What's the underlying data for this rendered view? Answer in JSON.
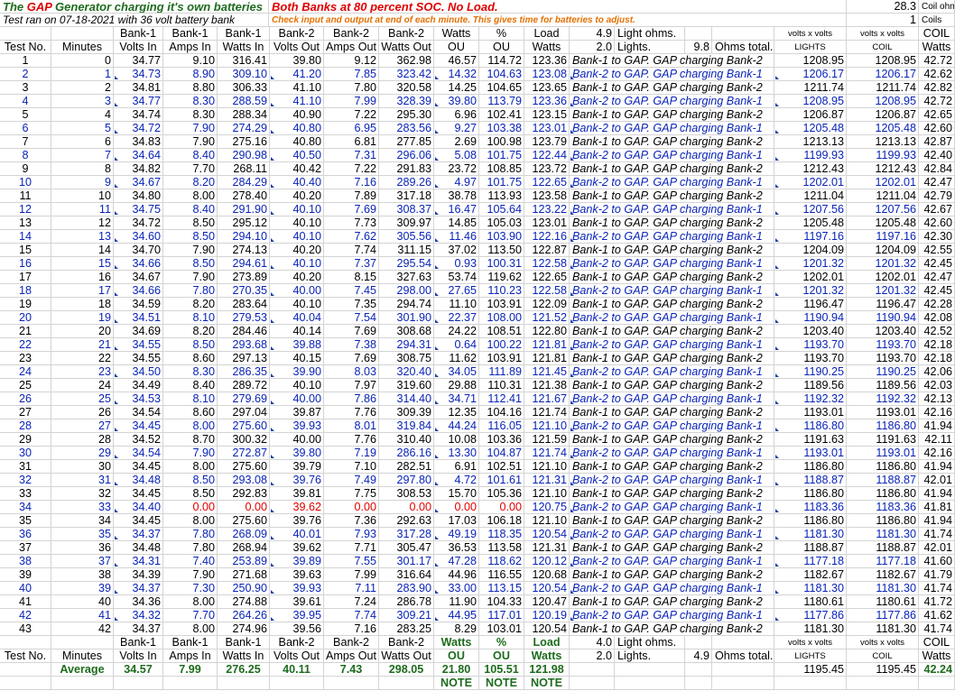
{
  "header": {
    "title_prefix": "The ",
    "title_gap": "GAP",
    "title_suffix": " Generator charging it's own batteries",
    "conditions": "Both Banks at 80 percent SOC. No Load.",
    "test_info": "Test ran on 07-18-2021 with 36 volt battery bank",
    "instructions": "Check input and output at end of each minute. This gives time for batteries to adjust.",
    "coil_ohms_value": "28.3",
    "coil_ohms_label": "Coil ohms",
    "coils_value": "1",
    "coils_label": "Coils"
  },
  "columns": {
    "top": [
      "",
      "",
      "Bank-1",
      "Bank-1",
      "Bank-1",
      "Bank-2",
      "Bank-2",
      "Bank-2",
      "Watts",
      "%",
      "Load",
      "4.9",
      "Light ohms.",
      "",
      "",
      "volts x volts",
      "volts x volts",
      "COIL"
    ],
    "bottom": [
      "Test No.",
      "Minutes",
      "Volts In",
      "Amps In",
      "Watts In",
      "Volts Out",
      "Amps Out",
      "Watts Out",
      "OU",
      "OU",
      "Watts",
      "2.0",
      "Lights.",
      "9.8",
      "Ohms total.",
      "LIGHTS",
      "COIL",
      "Watts"
    ]
  },
  "rows": [
    [
      "1",
      "0",
      "34.77",
      "9.10",
      "316.41",
      "39.80",
      "9.12",
      "362.98",
      "46.57",
      "114.72",
      "123.36",
      "Bank-1 to GAP. GAP charging Bank-2",
      "1208.95",
      "1208.95",
      "42.72"
    ],
    [
      "2",
      "1",
      "34.73",
      "8.90",
      "309.10",
      "41.20",
      "7.85",
      "323.42",
      "14.32",
      "104.63",
      "123.08",
      "Bank-2 to GAP. GAP charging Bank-1",
      "1206.17",
      "1206.17",
      "42.62"
    ],
    [
      "3",
      "2",
      "34.81",
      "8.80",
      "306.33",
      "41.10",
      "7.80",
      "320.58",
      "14.25",
      "104.65",
      "123.65",
      "Bank-1 to GAP. GAP charging Bank-2",
      "1211.74",
      "1211.74",
      "42.82"
    ],
    [
      "4",
      "3",
      "34.77",
      "8.30",
      "288.59",
      "41.10",
      "7.99",
      "328.39",
      "39.80",
      "113.79",
      "123.36",
      "Bank-2 to GAP. GAP charging Bank-1",
      "1208.95",
      "1208.95",
      "42.72"
    ],
    [
      "5",
      "4",
      "34.74",
      "8.30",
      "288.34",
      "40.90",
      "7.22",
      "295.30",
      "6.96",
      "102.41",
      "123.15",
      "Bank-1 to GAP. GAP charging Bank-2",
      "1206.87",
      "1206.87",
      "42.65"
    ],
    [
      "6",
      "5",
      "34.72",
      "7.90",
      "274.29",
      "40.80",
      "6.95",
      "283.56",
      "9.27",
      "103.38",
      "123.01",
      "Bank-2 to GAP. GAP charging Bank-1",
      "1205.48",
      "1205.48",
      "42.60"
    ],
    [
      "7",
      "6",
      "34.83",
      "7.90",
      "275.16",
      "40.80",
      "6.81",
      "277.85",
      "2.69",
      "100.98",
      "123.79",
      "Bank-1 to GAP. GAP charging Bank-2",
      "1213.13",
      "1213.13",
      "42.87"
    ],
    [
      "8",
      "7",
      "34.64",
      "8.40",
      "290.98",
      "40.50",
      "7.31",
      "296.06",
      "5.08",
      "101.75",
      "122.44",
      "Bank-2 to GAP. GAP charging Bank-1",
      "1199.93",
      "1199.93",
      "42.40"
    ],
    [
      "9",
      "8",
      "34.82",
      "7.70",
      "268.11",
      "40.42",
      "7.22",
      "291.83",
      "23.72",
      "108.85",
      "123.72",
      "Bank-1 to GAP. GAP charging Bank-2",
      "1212.43",
      "1212.43",
      "42.84"
    ],
    [
      "10",
      "9",
      "34.67",
      "8.20",
      "284.29",
      "40.40",
      "7.16",
      "289.26",
      "4.97",
      "101.75",
      "122.65",
      "Bank-2 to GAP. GAP charging Bank-1",
      "1202.01",
      "1202.01",
      "42.47"
    ],
    [
      "11",
      "10",
      "34.80",
      "8.00",
      "278.40",
      "40.20",
      "7.89",
      "317.18",
      "38.78",
      "113.93",
      "123.58",
      "Bank-1 to GAP. GAP charging Bank-2",
      "1211.04",
      "1211.04",
      "42.79"
    ],
    [
      "12",
      "11",
      "34.75",
      "8.40",
      "291.90",
      "40.10",
      "7.69",
      "308.37",
      "16.47",
      "105.64",
      "123.22",
      "Bank-2 to GAP. GAP charging Bank-1",
      "1207.56",
      "1207.56",
      "42.67"
    ],
    [
      "13",
      "12",
      "34.72",
      "8.50",
      "295.12",
      "40.10",
      "7.73",
      "309.97",
      "14.85",
      "105.03",
      "123.01",
      "Bank-1 to GAP. GAP charging Bank-2",
      "1205.48",
      "1205.48",
      "42.60"
    ],
    [
      "14",
      "13",
      "34.60",
      "8.50",
      "294.10",
      "40.10",
      "7.62",
      "305.56",
      "11.46",
      "103.90",
      "122.16",
      "Bank-2 to GAP. GAP charging Bank-1",
      "1197.16",
      "1197.16",
      "42.30"
    ],
    [
      "15",
      "14",
      "34.70",
      "7.90",
      "274.13",
      "40.20",
      "7.74",
      "311.15",
      "37.02",
      "113.50",
      "122.87",
      "Bank-1 to GAP. GAP charging Bank-2",
      "1204.09",
      "1204.09",
      "42.55"
    ],
    [
      "16",
      "15",
      "34.66",
      "8.50",
      "294.61",
      "40.10",
      "7.37",
      "295.54",
      "0.93",
      "100.31",
      "122.58",
      "Bank-2 to GAP. GAP charging Bank-1",
      "1201.32",
      "1201.32",
      "42.45"
    ],
    [
      "17",
      "16",
      "34.67",
      "7.90",
      "273.89",
      "40.20",
      "8.15",
      "327.63",
      "53.74",
      "119.62",
      "122.65",
      "Bank-1 to GAP. GAP charging Bank-2",
      "1202.01",
      "1202.01",
      "42.47"
    ],
    [
      "18",
      "17",
      "34.66",
      "7.80",
      "270.35",
      "40.00",
      "7.45",
      "298.00",
      "27.65",
      "110.23",
      "122.58",
      "Bank-2 to GAP. GAP charging Bank-1",
      "1201.32",
      "1201.32",
      "42.45"
    ],
    [
      "19",
      "18",
      "34.59",
      "8.20",
      "283.64",
      "40.10",
      "7.35",
      "294.74",
      "11.10",
      "103.91",
      "122.09",
      "Bank-1 to GAP. GAP charging Bank-2",
      "1196.47",
      "1196.47",
      "42.28"
    ],
    [
      "20",
      "19",
      "34.51",
      "8.10",
      "279.53",
      "40.04",
      "7.54",
      "301.90",
      "22.37",
      "108.00",
      "121.52",
      "Bank-2 to GAP. GAP charging Bank-1",
      "1190.94",
      "1190.94",
      "42.08"
    ],
    [
      "21",
      "20",
      "34.69",
      "8.20",
      "284.46",
      "40.14",
      "7.69",
      "308.68",
      "24.22",
      "108.51",
      "122.80",
      "Bank-1 to GAP. GAP charging Bank-2",
      "1203.40",
      "1203.40",
      "42.52"
    ],
    [
      "22",
      "21",
      "34.55",
      "8.50",
      "293.68",
      "39.88",
      "7.38",
      "294.31",
      "0.64",
      "100.22",
      "121.81",
      "Bank-2 to GAP. GAP charging Bank-1",
      "1193.70",
      "1193.70",
      "42.18"
    ],
    [
      "23",
      "22",
      "34.55",
      "8.60",
      "297.13",
      "40.15",
      "7.69",
      "308.75",
      "11.62",
      "103.91",
      "121.81",
      "Bank-1 to GAP. GAP charging Bank-2",
      "1193.70",
      "1193.70",
      "42.18"
    ],
    [
      "24",
      "23",
      "34.50",
      "8.30",
      "286.35",
      "39.90",
      "8.03",
      "320.40",
      "34.05",
      "111.89",
      "121.45",
      "Bank-2 to GAP. GAP charging Bank-1",
      "1190.25",
      "1190.25",
      "42.06"
    ],
    [
      "25",
      "24",
      "34.49",
      "8.40",
      "289.72",
      "40.10",
      "7.97",
      "319.60",
      "29.88",
      "110.31",
      "121.38",
      "Bank-1 to GAP. GAP charging Bank-2",
      "1189.56",
      "1189.56",
      "42.03"
    ],
    [
      "26",
      "25",
      "34.53",
      "8.10",
      "279.69",
      "40.00",
      "7.86",
      "314.40",
      "34.71",
      "112.41",
      "121.67",
      "Bank-2 to GAP. GAP charging Bank-1",
      "1192.32",
      "1192.32",
      "42.13"
    ],
    [
      "27",
      "26",
      "34.54",
      "8.60",
      "297.04",
      "39.87",
      "7.76",
      "309.39",
      "12.35",
      "104.16",
      "121.74",
      "Bank-1 to GAP. GAP charging Bank-2",
      "1193.01",
      "1193.01",
      "42.16"
    ],
    [
      "28",
      "27",
      "34.45",
      "8.00",
      "275.60",
      "39.93",
      "8.01",
      "319.84",
      "44.24",
      "116.05",
      "121.10",
      "Bank-2 to GAP. GAP charging Bank-1",
      "1186.80",
      "1186.80",
      "41.94"
    ],
    [
      "29",
      "28",
      "34.52",
      "8.70",
      "300.32",
      "40.00",
      "7.76",
      "310.40",
      "10.08",
      "103.36",
      "121.59",
      "Bank-1 to GAP. GAP charging Bank-2",
      "1191.63",
      "1191.63",
      "42.11"
    ],
    [
      "30",
      "29",
      "34.54",
      "7.90",
      "272.87",
      "39.80",
      "7.19",
      "286.16",
      "13.30",
      "104.87",
      "121.74",
      "Bank-2 to GAP. GAP charging Bank-1",
      "1193.01",
      "1193.01",
      "42.16"
    ],
    [
      "31",
      "30",
      "34.45",
      "8.00",
      "275.60",
      "39.79",
      "7.10",
      "282.51",
      "6.91",
      "102.51",
      "121.10",
      "Bank-1 to GAP. GAP charging Bank-2",
      "1186.80",
      "1186.80",
      "41.94"
    ],
    [
      "32",
      "31",
      "34.48",
      "8.50",
      "293.08",
      "39.76",
      "7.49",
      "297.80",
      "4.72",
      "101.61",
      "121.31",
      "Bank-2 to GAP. GAP charging Bank-1",
      "1188.87",
      "1188.87",
      "42.01"
    ],
    [
      "33",
      "32",
      "34.45",
      "8.50",
      "292.83",
      "39.81",
      "7.75",
      "308.53",
      "15.70",
      "105.36",
      "121.10",
      "Bank-1 to GAP. GAP charging Bank-2",
      "1186.80",
      "1186.80",
      "41.94"
    ],
    [
      "34",
      "33",
      "34.40",
      "0.00",
      "0.00",
      "39.62",
      "0.00",
      "0.00",
      "0.00",
      "0.00",
      "120.75",
      "Bank-2 to GAP. GAP charging Bank-1",
      "1183.36",
      "1183.36",
      "41.81"
    ],
    [
      "35",
      "34",
      "34.45",
      "8.00",
      "275.60",
      "39.76",
      "7.36",
      "292.63",
      "17.03",
      "106.18",
      "121.10",
      "Bank-1 to GAP. GAP charging Bank-2",
      "1186.80",
      "1186.80",
      "41.94"
    ],
    [
      "36",
      "35",
      "34.37",
      "7.80",
      "268.09",
      "40.01",
      "7.93",
      "317.28",
      "49.19",
      "118.35",
      "120.54",
      "Bank-2 to GAP. GAP charging Bank-1",
      "1181.30",
      "1181.30",
      "41.74"
    ],
    [
      "37",
      "36",
      "34.48",
      "7.80",
      "268.94",
      "39.62",
      "7.71",
      "305.47",
      "36.53",
      "113.58",
      "121.31",
      "Bank-1 to GAP. GAP charging Bank-2",
      "1188.87",
      "1188.87",
      "42.01"
    ],
    [
      "38",
      "37",
      "34.31",
      "7.40",
      "253.89",
      "39.89",
      "7.55",
      "301.17",
      "47.28",
      "118.62",
      "120.12",
      "Bank-2 to GAP. GAP charging Bank-1",
      "1177.18",
      "1177.18",
      "41.60"
    ],
    [
      "39",
      "38",
      "34.39",
      "7.90",
      "271.68",
      "39.63",
      "7.99",
      "316.64",
      "44.96",
      "116.55",
      "120.68",
      "Bank-1 to GAP. GAP charging Bank-2",
      "1182.67",
      "1182.67",
      "41.79"
    ],
    [
      "40",
      "39",
      "34.37",
      "7.30",
      "250.90",
      "39.93",
      "7.11",
      "283.90",
      "33.00",
      "113.15",
      "120.54",
      "Bank-2 to GAP. GAP charging Bank-1",
      "1181.30",
      "1181.30",
      "41.74"
    ],
    [
      "41",
      "40",
      "34.36",
      "8.00",
      "274.88",
      "39.61",
      "7.24",
      "286.78",
      "11.90",
      "104.33",
      "120.47",
      "Bank-1 to GAP. GAP charging Bank-2",
      "1180.61",
      "1180.61",
      "41.72"
    ],
    [
      "42",
      "41",
      "34.32",
      "7.70",
      "264.26",
      "39.95",
      "7.74",
      "309.21",
      "44.95",
      "117.01",
      "120.19",
      "Bank-2 to GAP. GAP charging Bank-1",
      "1177.86",
      "1177.86",
      "41.62"
    ],
    [
      "43",
      "42",
      "34.37",
      "8.00",
      "274.96",
      "39.56",
      "7.16",
      "283.25",
      "8.29",
      "103.01",
      "120.54",
      "Bank-1 to GAP. GAP charging Bank-2",
      "1181.30",
      "1181.30",
      "41.74"
    ]
  ],
  "footer": {
    "top": [
      "",
      "",
      "Bank-1",
      "Bank-1",
      "Bank-1",
      "Bank-2",
      "Bank-2",
      "Bank-2",
      "Watts",
      "%",
      "Load",
      "4.0",
      "Light ohms.",
      "",
      "",
      "volts x volts",
      "volts x volts",
      "COIL"
    ],
    "bottom": [
      "Test No.",
      "Minutes",
      "Volts In",
      "Amps In",
      "Watts In",
      "Volts Out",
      "Amps Out",
      "Watts Out",
      "OU",
      "OU",
      "Watts",
      "2.0",
      "Lights.",
      "4.9",
      "Ohms total.",
      "LIGHTS",
      "COIL",
      "Watts"
    ],
    "average": [
      "",
      "Average",
      "34.57",
      "7.99",
      "276.25",
      "40.11",
      "7.43",
      "298.05",
      "21.80",
      "105.51",
      "121.98",
      "",
      "",
      "",
      "",
      "1195.45",
      "1195.45",
      "42.24"
    ],
    "note": [
      "",
      "",
      "",
      "",
      "",
      "",
      "",
      "",
      "NOTE",
      "NOTE",
      "NOTE",
      "",
      "",
      "",
      "",
      "",
      "",
      ""
    ]
  },
  "colors": {
    "blue_text": "#0a24b8",
    "red_text": "#e00000",
    "green_text": "#1e6b1e",
    "orange_text": "#e37000",
    "grid": "#d4d4d4"
  }
}
